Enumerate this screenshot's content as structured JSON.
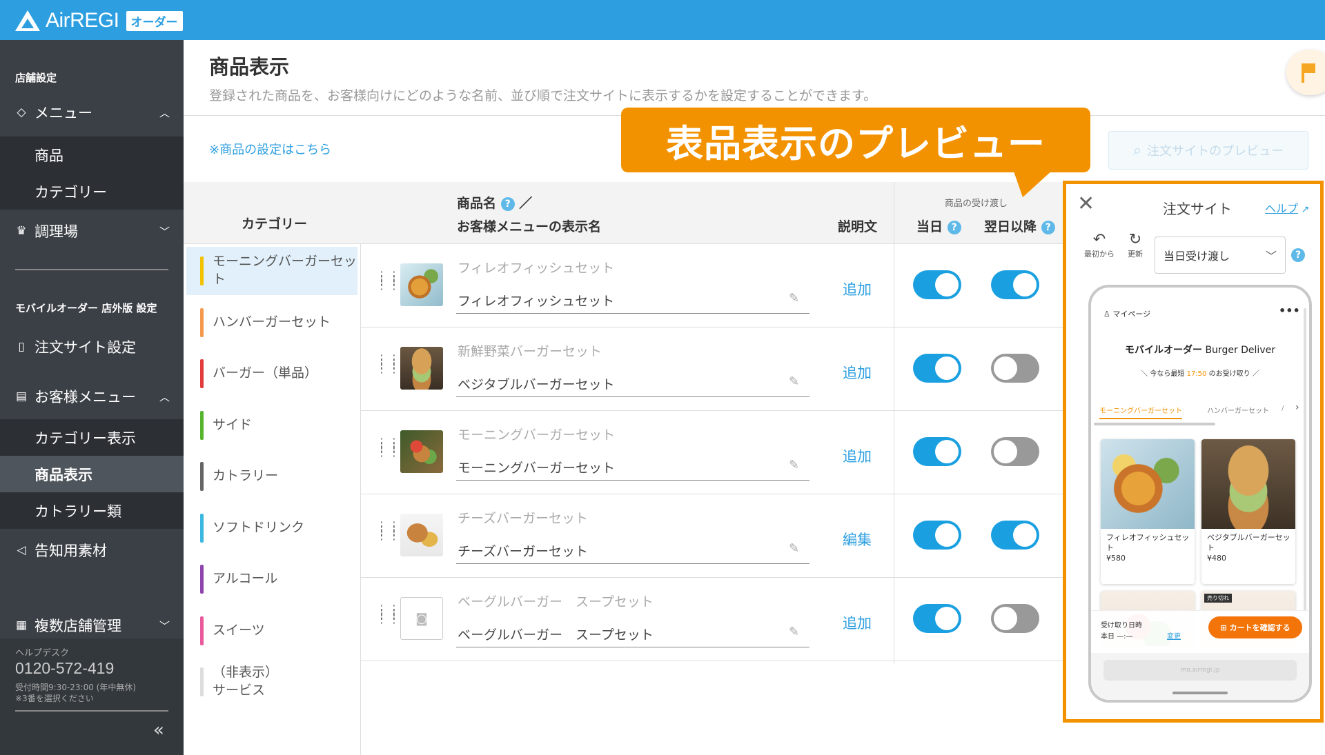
{
  "app": {
    "brand": "AirREGI",
    "badge": "オーダー"
  },
  "sidebar": {
    "section_store": "店舗設定",
    "menu_label": "メニュー",
    "menu_sub": [
      "商品",
      "カテゴリー"
    ],
    "kitchen_label": "調理場",
    "section_mobile": "モバイルオーダー 店外版 設定",
    "order_site_label": "注文サイト設定",
    "customer_menu_label": "お客様メニュー",
    "customer_sub": [
      "カテゴリー表示",
      "商品表示",
      "カトラリー類"
    ],
    "promo_label": "告知用素材",
    "multi_store_label": "複数店舗管理",
    "helpdesk": {
      "title": "ヘルプデスク",
      "phone": "0120-572-419",
      "hours": "受付時間9:30-23:00 (年中無休)",
      "note": "※3番を選択ください"
    },
    "collapse": "«"
  },
  "page": {
    "title": "商品表示",
    "description": "登録された商品を、お客様向けにどのような名前、並び順で注文サイトに表示するかを設定することができます。",
    "settings_link": "※商品の設定はこちら",
    "preview_button": "注文サイトのプレビュー"
  },
  "callout": "表品表示のプレビュー",
  "table": {
    "col_category": "カテゴリー",
    "col_name_1": "商品名",
    "col_name_sep": "／",
    "col_name_2": "お客様メニューの表示名",
    "col_desc": "説明文",
    "col_handover": "商品の受け渡し",
    "col_today": "当日",
    "col_later": "翌日以降"
  },
  "categories": [
    {
      "label": "モーニングバーガーセット",
      "color": "#f2c200",
      "selected": true
    },
    {
      "label": "ハンバーガーセット",
      "color": "#f39a4e"
    },
    {
      "label": "バーガー（単品）",
      "color": "#e23b3b"
    },
    {
      "label": "サイド",
      "color": "#57b42f"
    },
    {
      "label": "カトラリー",
      "color": "#666666"
    },
    {
      "label": "ソフトドリンク",
      "color": "#3cb8e0"
    },
    {
      "label": "アルコール",
      "color": "#8e44ad"
    },
    {
      "label": "スイーツ",
      "color": "#e85a9b"
    },
    {
      "label": "（非表示）\nサービス",
      "color": "#dddddd"
    }
  ],
  "products": [
    {
      "name": "フィレオフィッシュセット",
      "display": "フィレオフィッシュセット",
      "desc_action": "追加",
      "today": true,
      "later": true,
      "thumb": "fish"
    },
    {
      "name": "新鮮野菜バーガーセット",
      "display": "ベジタブルバーガーセット",
      "desc_action": "追加",
      "today": true,
      "later": false,
      "thumb": "veg"
    },
    {
      "name": "モーニングバーガーセット",
      "display": "モーニングバーガーセット",
      "desc_action": "追加",
      "today": true,
      "later": false,
      "thumb": "morning"
    },
    {
      "name": "チーズバーガーセット",
      "display": "チーズバーガーセット",
      "desc_action": "編集",
      "today": true,
      "later": true,
      "thumb": "cheese"
    },
    {
      "name": "ベーグルバーガー　スープセット",
      "display": "ベーグルバーガー　スープセット",
      "desc_action": "追加",
      "today": true,
      "later": false,
      "thumb": "none"
    }
  ],
  "preview": {
    "title": "注文サイト",
    "help": "ヘルプ",
    "reset": "最初から",
    "refresh": "更新",
    "select": "当日受け渡し",
    "mypage": "マイページ",
    "shop_name_jp": "モバイルオーダー",
    "shop_name_en": "Burger Deliver",
    "pickup_prefix": "＼ 今なら最短",
    "pickup_time": "17:50",
    "pickup_suffix": "のお受け取り ／",
    "tabs": [
      "モーニングバーガーセット",
      "ハンバーガーセット",
      "/"
    ],
    "items": [
      {
        "name": "フィレオフィッシュセット",
        "price": "¥580"
      },
      {
        "name": "ベジタブルバーガーセット",
        "price": "¥480"
      }
    ],
    "sold_out": "売り切れ",
    "pickup_label": "受け取り日時",
    "pickup_value": "本日 —:—",
    "change": "変更",
    "cart": "カートを確認する",
    "url": "mo.airregi.jp"
  },
  "colors": {
    "accent": "#2d9fe0",
    "sidebar": "#3b4046",
    "callout": "#f39200",
    "toggle_on": "#1aa0e1"
  }
}
